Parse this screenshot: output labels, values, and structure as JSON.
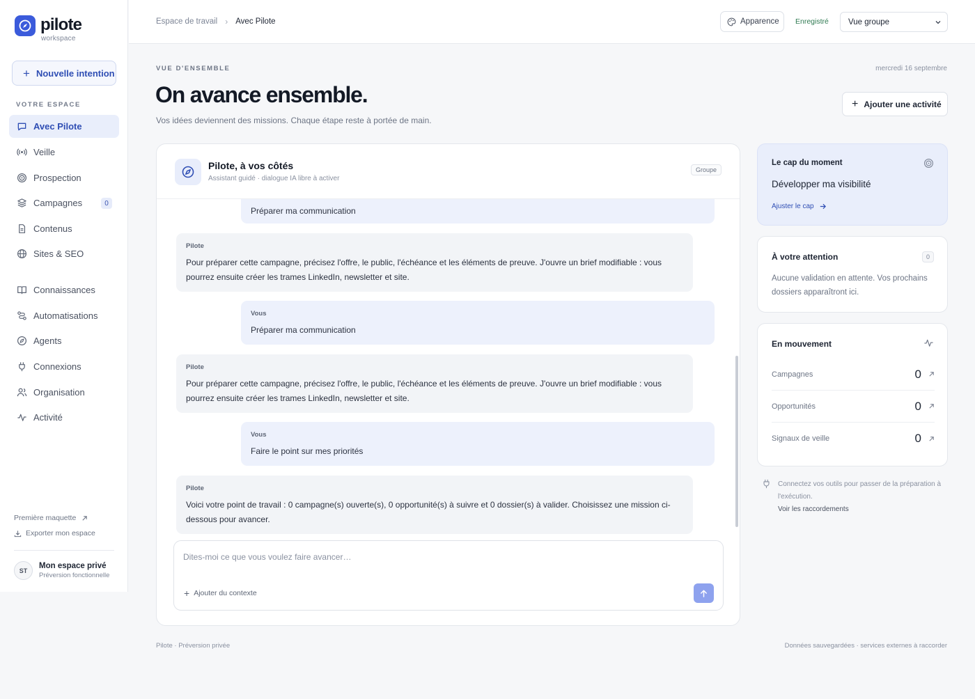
{
  "sidebar": {
    "logo_name": "pilote",
    "logo_sub": "workspace",
    "new_intent_label": "Nouvelle intention",
    "section_label": "VOTRE ESPACE",
    "items": [
      {
        "label": "Avec Pilote",
        "icon": "chat-icon"
      },
      {
        "label": "Veille",
        "icon": "radar-icon"
      },
      {
        "label": "Prospection",
        "icon": "target-icon"
      },
      {
        "label": "Campagnes",
        "icon": "layers-icon",
        "badge": "0"
      },
      {
        "label": "Contenus",
        "icon": "document-icon"
      },
      {
        "label": "Sites & SEO",
        "icon": "globe-icon"
      },
      {
        "label": "Connaissances",
        "icon": "book-icon"
      },
      {
        "label": "Automatisations",
        "icon": "workflow-icon"
      },
      {
        "label": "Agents",
        "icon": "compass-icon"
      },
      {
        "label": "Connexions",
        "icon": "plug-icon"
      },
      {
        "label": "Organisation",
        "icon": "users-icon"
      },
      {
        "label": "Activité",
        "icon": "pulse-icon"
      }
    ],
    "footer_links": {
      "first_mockup": "Première maquette",
      "export": "Exporter mon espace"
    },
    "profile": {
      "initials": "ST",
      "name": "Mon espace privé",
      "sub": "Préversion fonctionnelle"
    }
  },
  "topbar": {
    "breadcrumb_parent": "Espace de travail",
    "breadcrumb_current": "Avec Pilote",
    "appearance_label": "Apparence",
    "saved_label": "Enregistré",
    "view_select": "Vue groupe"
  },
  "header": {
    "eyebrow": "VUE D'ENSEMBLE",
    "date": "mercredi 16 septembre",
    "title": "On avance ensemble.",
    "subtitle": "Vos idées deviennent des missions. Chaque étape reste à portée de main.",
    "add_activity_label": "Ajouter une activité"
  },
  "chat": {
    "title": "Pilote, à vos côtés",
    "subtitle": "Assistant guidé · dialogue IA libre à activer",
    "badge": "Groupe",
    "messages": [
      {
        "who": "",
        "role": "user",
        "text": "Préparer ma communication"
      },
      {
        "who": "Pilote",
        "role": "bot",
        "text": "Pour préparer cette campagne, précisez l'offre, le public, l'échéance et les éléments de preuve. J'ouvre un brief modifiable : vous pourrez ensuite créer les trames LinkedIn, newsletter et site."
      },
      {
        "who": "Vous",
        "role": "user",
        "text": "Préparer ma communication"
      },
      {
        "who": "Pilote",
        "role": "bot",
        "text": "Pour préparer cette campagne, précisez l'offre, le public, l'échéance et les éléments de preuve. J'ouvre un brief modifiable : vous pourrez ensuite créer les trames LinkedIn, newsletter et site."
      },
      {
        "who": "Vous",
        "role": "user",
        "text": "Faire le point sur mes priorités"
      },
      {
        "who": "Pilote",
        "role": "bot",
        "text": "Voici votre point de travail : 0 campagne(s) ouverte(s), 0 opportunité(s) à suivre et 0 dossier(s) à valider. Choisissez une mission ci-dessous pour avancer."
      }
    ],
    "composer_placeholder": "Dites-moi ce que vous voulez faire avancer…",
    "add_context_label": "Ajouter du contexte"
  },
  "right": {
    "cap": {
      "title": "Le cap du moment",
      "value": "Développer ma visibilité",
      "link": "Ajuster le cap"
    },
    "attention": {
      "title": "À votre attention",
      "count": "0",
      "body": "Aucune validation en attente. Vos prochains dossiers apparaîtront ici."
    },
    "movement": {
      "title": "En mouvement",
      "rows": [
        {
          "label": "Campagnes",
          "value": "0"
        },
        {
          "label": "Opportunités",
          "value": "0"
        },
        {
          "label": "Signaux de veille",
          "value": "0"
        }
      ]
    },
    "connect_note": "Connectez vos outils pour passer de la préparation à l'exécution.",
    "connect_link": "Voir les raccordements"
  },
  "footer": {
    "left": "Pilote · Préversion privée",
    "right": "Données sauvegardées · services externes à raccorder"
  },
  "colors": {
    "accent": "#3b5bdb",
    "accent_soft": "#e9eefb",
    "saved": "#2f7a52",
    "send": "#8ea2ee"
  }
}
